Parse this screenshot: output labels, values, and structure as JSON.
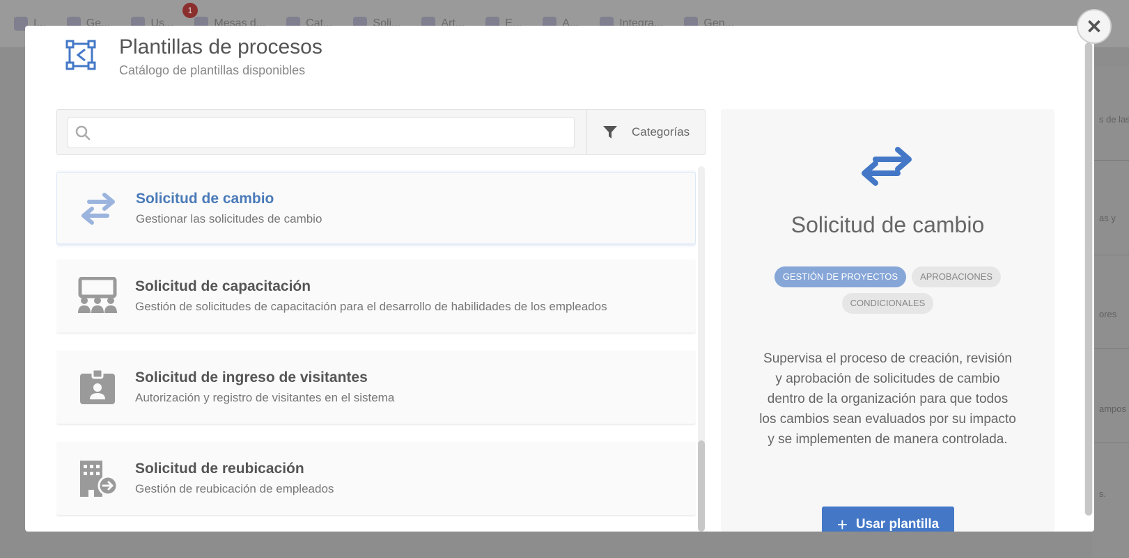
{
  "background": {
    "tabs": [
      "I...",
      "Ge...",
      "Us...",
      "Mesas d...",
      "Cat...",
      "Soli...",
      "Art...",
      "E...",
      "A...",
      "Integra...",
      "Gen..."
    ],
    "badge": "1",
    "right_texts": [
      "s de las",
      "as y",
      "ores",
      "ampos",
      "s."
    ]
  },
  "modal": {
    "title": "Plantillas de procesos",
    "subtitle": "Catálogo de plantillas disponibles",
    "search": {
      "placeholder": "",
      "value": ""
    },
    "categories_label": "Categorías",
    "templates": [
      {
        "title": "Solicitud de cambio",
        "description": "Gestionar las solicitudes de cambio",
        "icon": "arrows-exchange-icon",
        "selected": true
      },
      {
        "title": "Solicitud de capacitación",
        "description": "Gestión de solicitudes de capacitación para el desarrollo de habilidades de los empleados",
        "icon": "training-board-icon",
        "selected": false
      },
      {
        "title": "Solicitud de ingreso de visitantes",
        "description": "Autorización y registro de visitantes en el sistema",
        "icon": "id-badge-icon",
        "selected": false
      },
      {
        "title": "Solicitud de reubicación",
        "description": "Gestión de reubicación de empleados",
        "icon": "building-relocate-icon",
        "selected": false
      }
    ],
    "detail": {
      "title": "Solicitud de cambio",
      "tags": [
        "GESTIÓN DE PROYECTOS",
        "APROBACIONES",
        "CONDICIONALES"
      ],
      "description": "Supervisa el proceso de creación, revisión y aprobación de solicitudes de cambio dentro de la organización para que todos los cambios sean evaluados por su impacto y se implementen de manera controlada.",
      "use_button": "Usar plantilla"
    }
  },
  "colors": {
    "accent": "#4478c7",
    "selected_title": "#4a7ab8",
    "tag_active": "#86a6d8"
  }
}
